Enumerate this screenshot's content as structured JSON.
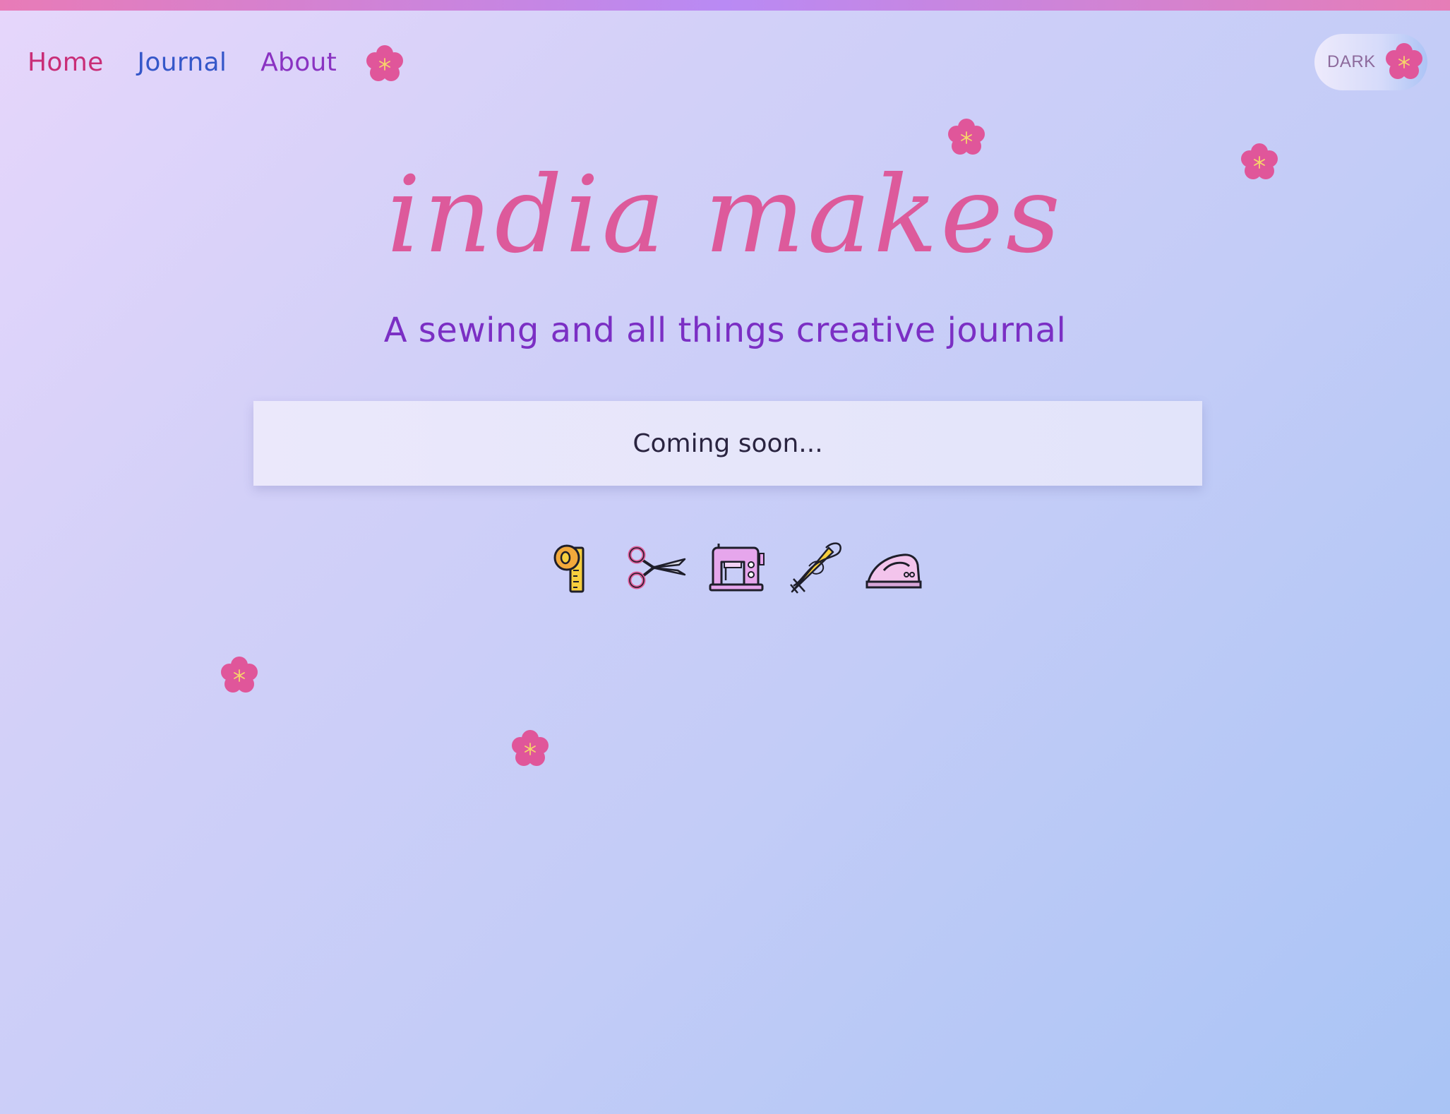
{
  "nav": {
    "home": "Home",
    "journal": "Journal",
    "about": "About"
  },
  "toggle": {
    "label": "DARK"
  },
  "hero": {
    "title": "india makes",
    "subtitle": "A sewing and all things creative journal"
  },
  "card": {
    "text": "Coming soon..."
  },
  "icons": {
    "decor": "flower-icon",
    "tools": [
      "measuring-tape-icon",
      "scissors-icon",
      "sewing-machine-icon",
      "needle-thread-icon",
      "iron-icon"
    ]
  },
  "colors": {
    "home": "#c92d77",
    "journal": "#3557c9",
    "about": "#8a33c2",
    "title": "#dd5a9b",
    "subtitle": "#7b2fc4",
    "flower": "#e0569a"
  }
}
